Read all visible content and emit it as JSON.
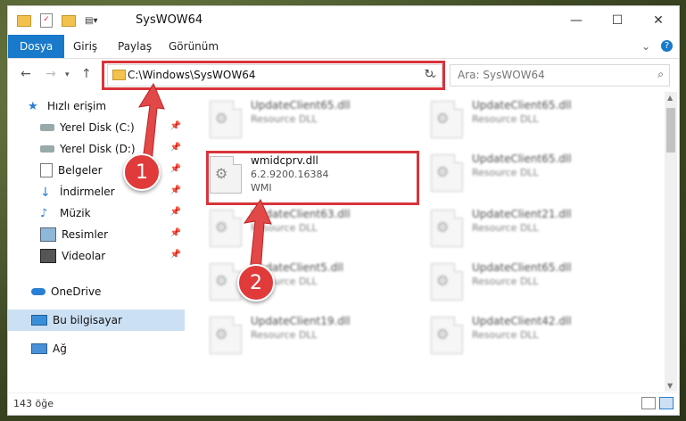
{
  "window": {
    "title": "SysWOW64",
    "minimize_label": "—",
    "maximize_label": "☐",
    "close_label": "✕"
  },
  "ribbon": {
    "tabs": [
      "Dosya",
      "Giriş",
      "Paylaş",
      "Görünüm"
    ],
    "expand_label": "⌄",
    "help_label": "?"
  },
  "address": {
    "path": "C:\\Windows\\SysWOW64",
    "search_placeholder": "Ara: SysWOW64"
  },
  "sidebar": {
    "items": [
      {
        "label": "Hızlı erişim",
        "icon": "star-icon",
        "pinned": false
      },
      {
        "label": "Yerel Disk (C:)",
        "icon": "drive-icon",
        "pinned": true
      },
      {
        "label": "Yerel Disk (D:)",
        "icon": "drive-icon",
        "pinned": true
      },
      {
        "label": "Belgeler",
        "icon": "documents-icon",
        "pinned": true
      },
      {
        "label": "İndirmeler",
        "icon": "download-icon",
        "pinned": true
      },
      {
        "label": "Müzik",
        "icon": "music-icon",
        "pinned": true
      },
      {
        "label": "Resimler",
        "icon": "pictures-icon",
        "pinned": true
      },
      {
        "label": "Videolar",
        "icon": "videos-icon",
        "pinned": true
      },
      {
        "label": "OneDrive",
        "icon": "cloud-icon",
        "pinned": false
      },
      {
        "label": "Bu bilgisayar",
        "icon": "computer-icon",
        "pinned": false
      },
      {
        "label": "Ağ",
        "icon": "network-icon",
        "pinned": false
      }
    ]
  },
  "files": {
    "left": [
      {
        "name": "UpdateClient65.dll",
        "line2": "Resource DLL",
        "line3": ""
      },
      {
        "name": "wmidcprv.dll",
        "line2": "6.2.9200.16384",
        "line3": "WMI"
      },
      {
        "name": "UpdateClient63.dll",
        "line2": "Resource DLL",
        "line3": ""
      },
      {
        "name": "UpdateClient5.dll",
        "line2": "Resource DLL",
        "line3": ""
      },
      {
        "name": "UpdateClient19.dll",
        "line2": "Resource DLL",
        "line3": ""
      }
    ],
    "right": [
      {
        "name": "UpdateClient65.dll",
        "line2": "Resource DLL"
      },
      {
        "name": "UpdateClient65.dll",
        "line2": "Resource DLL"
      },
      {
        "name": "UpdateClient21.dll",
        "line2": "Resource DLL"
      },
      {
        "name": "UpdateClient65.dll",
        "line2": "Resource DLL"
      },
      {
        "name": "UpdateClient42.dll",
        "line2": "Resource DLL"
      }
    ]
  },
  "status": {
    "item_count": "143 öğe"
  },
  "callouts": [
    "1",
    "2"
  ],
  "colors": {
    "accent": "#1979ca",
    "highlight": "#d9343a",
    "selected": "#cce0f3"
  }
}
